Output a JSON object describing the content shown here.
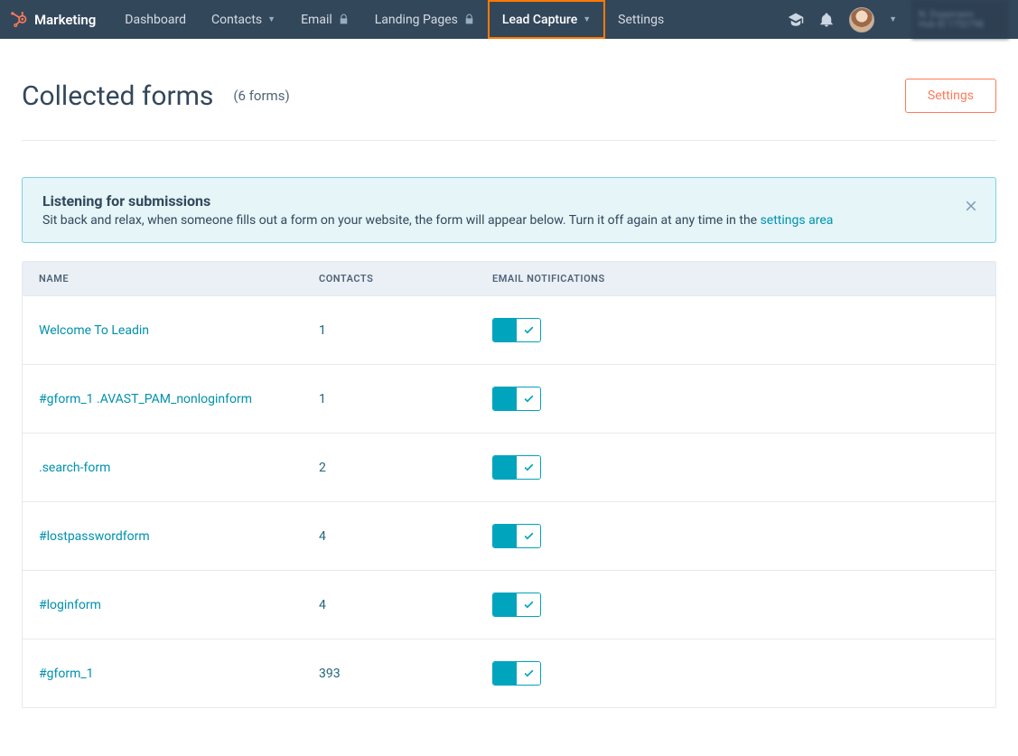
{
  "nav": {
    "brand": "Marketing",
    "items": [
      {
        "label": "Dashboard",
        "dropdown": false,
        "locked": false
      },
      {
        "label": "Contacts",
        "dropdown": true,
        "locked": false
      },
      {
        "label": "Email",
        "dropdown": false,
        "locked": true
      },
      {
        "label": "Landing Pages",
        "dropdown": false,
        "locked": true
      },
      {
        "label": "Lead Capture",
        "dropdown": true,
        "locked": false,
        "active": true
      },
      {
        "label": "Settings",
        "dropdown": false,
        "locked": false
      }
    ],
    "account_line1": "N. Doppmann",
    "account_line2": "Hub ID 1752798"
  },
  "page": {
    "title": "Collected forms",
    "subtitle": "(6 forms)",
    "settings_button": "Settings"
  },
  "banner": {
    "title": "Listening for submissions",
    "text_before": "Sit back and relax, when someone fills out a form on your website, the form will appear below. Turn it off again at any time in the ",
    "link_text": "settings area"
  },
  "table": {
    "headers": {
      "name": "NAME",
      "contacts": "CONTACTS",
      "notif": "EMAIL NOTIFICATIONS"
    },
    "rows": [
      {
        "name": "Welcome To Leadin",
        "contacts": "1"
      },
      {
        "name": "#gform_1 .AVAST_PAM_nonloginform",
        "contacts": "1"
      },
      {
        "name": ".search-form",
        "contacts": "2"
      },
      {
        "name": "#lostpasswordform",
        "contacts": "4"
      },
      {
        "name": "#loginform",
        "contacts": "4"
      },
      {
        "name": "#gform_1",
        "contacts": "393"
      }
    ]
  }
}
